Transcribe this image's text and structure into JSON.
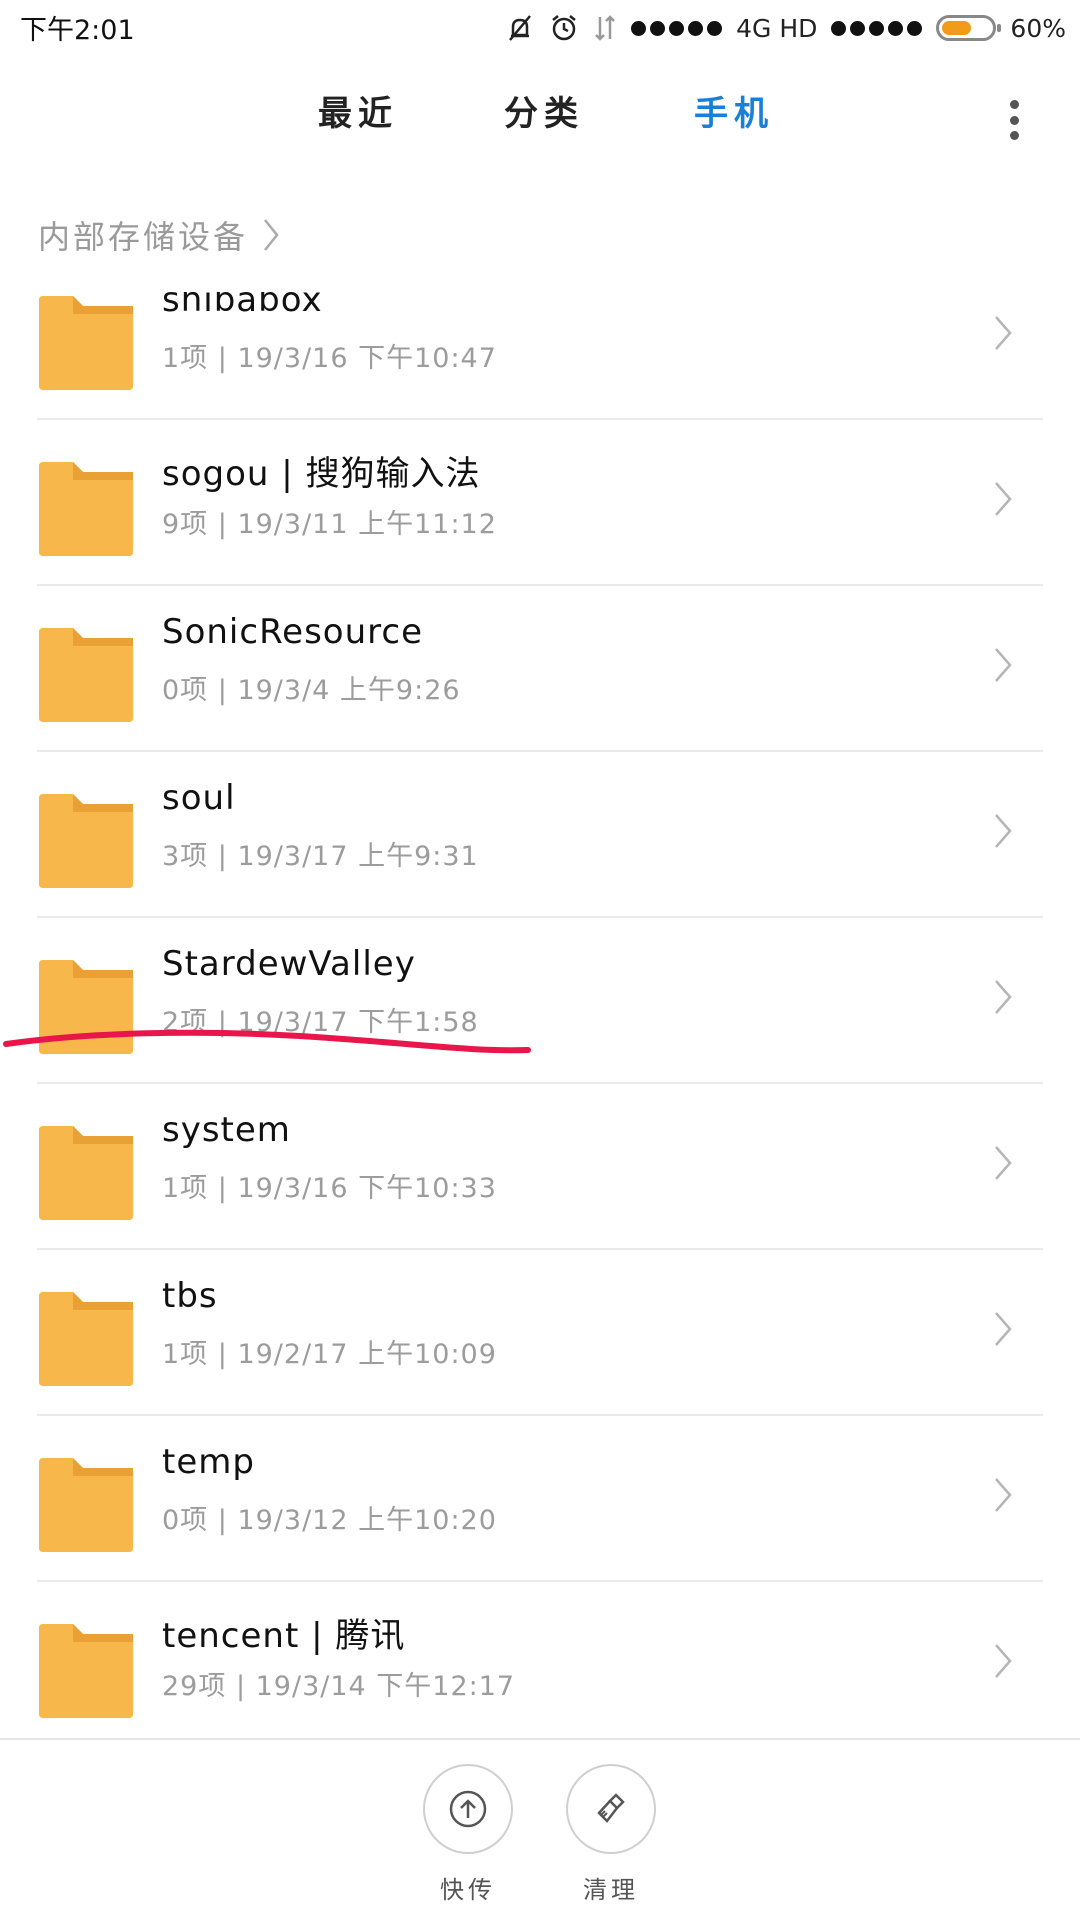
{
  "status_bar": {
    "time": "下午2:01",
    "network": "4G HD",
    "battery_percent": "60%",
    "battery_level": 0.6,
    "battery_color": "#f29b1a",
    "icons": [
      "mute-bell-icon",
      "alarm-clock-icon",
      "data-arrows-icon",
      "signal-dots-icon",
      "battery-icon"
    ]
  },
  "tabs": [
    {
      "label": "最近",
      "active": false
    },
    {
      "label": "分类",
      "active": false
    },
    {
      "label": "手机",
      "active": true
    }
  ],
  "accent_color": "#1a7fd6",
  "folder_color": "#f7b74a",
  "breadcrumb": {
    "label": "内部存储设备"
  },
  "folders": [
    {
      "name": "shibabox",
      "meta": "1项 | 19/3/16 下午10:47"
    },
    {
      "name": "sogou | 搜狗输入法",
      "meta": "9项 | 19/3/11 上午11:12"
    },
    {
      "name": "SonicResource",
      "meta": "0项 | 19/3/4 上午9:26"
    },
    {
      "name": "soul",
      "meta": "3项 | 19/3/17 上午9:31"
    },
    {
      "name": "StardewValley",
      "meta": "2项 | 19/3/17 下午1:58"
    },
    {
      "name": "system",
      "meta": "1项 | 19/3/16 下午10:33"
    },
    {
      "name": "tbs",
      "meta": "1项 | 19/2/17 上午10:09"
    },
    {
      "name": "temp",
      "meta": "0项 | 19/3/12 上午10:20"
    },
    {
      "name": "tencent | 腾讯",
      "meta": "29项 | 19/3/14 下午12:17"
    }
  ],
  "highlight_color": "#e8164a",
  "bottom_actions": [
    {
      "label": "快传",
      "icon": "upload-arrow-icon"
    },
    {
      "label": "清理",
      "icon": "broom-icon"
    }
  ]
}
